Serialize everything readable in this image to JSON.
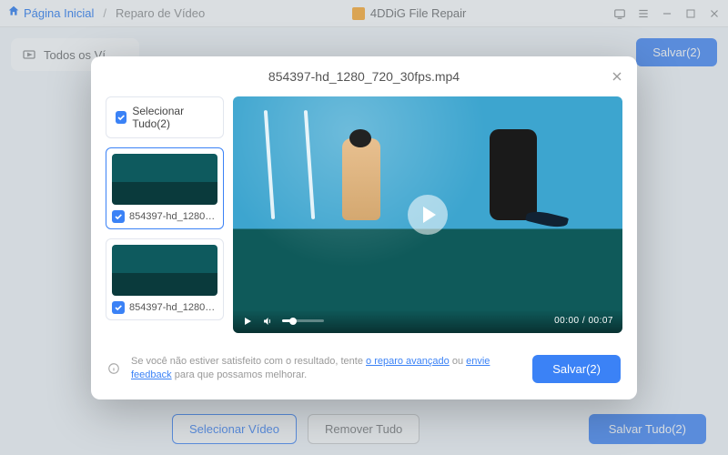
{
  "titlebar": {
    "home": "Página Inicial",
    "sep": "/",
    "current": "Reparo de Vídeo",
    "app_title": "4DDiG File Repair"
  },
  "sidebar": {
    "all_videos": "Todos os Ví…"
  },
  "bg": {
    "save_btn": "Salvar(2)",
    "select_video": "Selecionar Vídeo",
    "remove_all": "Remover Tudo",
    "save_all": "Salvar Tudo(2)",
    "file_title": "854397-hd_1280_720_30fps.mp4"
  },
  "modal": {
    "title": "854397-hd_1280_720_30fps.mp4",
    "select_all": "Selecionar Tudo(2)",
    "items": [
      {
        "name": "854397-hd_1280_7..."
      },
      {
        "name": "854397-hd_1280_7..."
      }
    ],
    "time_current": "00:00",
    "time_sep": " / ",
    "time_total": "00:07",
    "footer_prefix": "Se você não estiver satisfeito com o resultado, tente ",
    "footer_link1": "o reparo avançado",
    "footer_mid": " ou ",
    "footer_link2": "envie feedback",
    "footer_suffix": " para que possamos melhorar.",
    "save_btn": "Salvar(2)"
  }
}
